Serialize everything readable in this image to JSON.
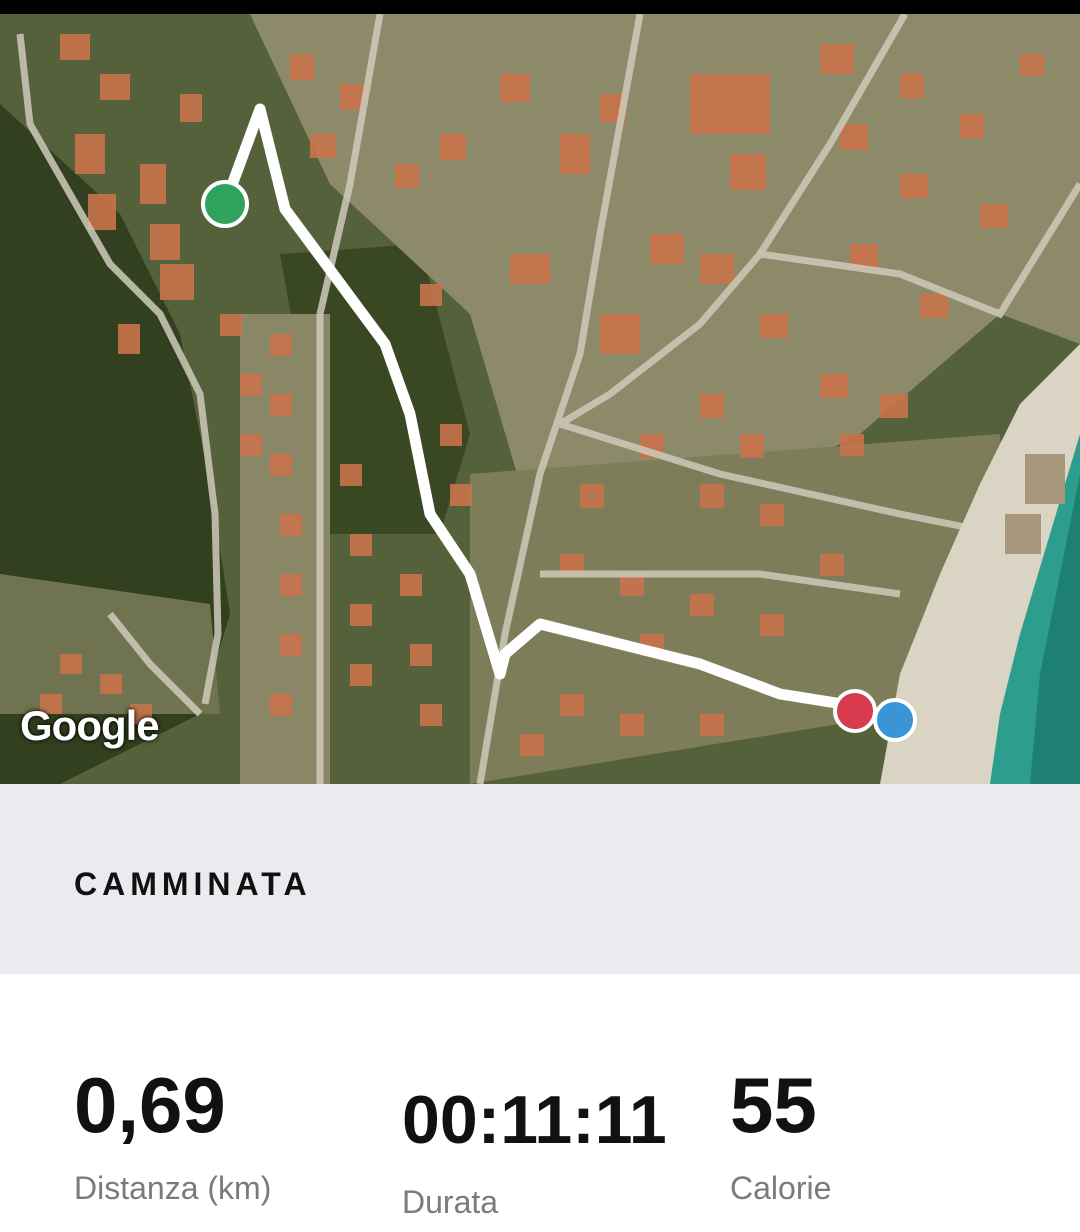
{
  "map": {
    "attribution": "Google",
    "markers": [
      {
        "name": "start",
        "color": "#2fa35e"
      },
      {
        "name": "end",
        "color": "#d83a4e"
      },
      {
        "name": "current",
        "color": "#3a95d6"
      }
    ],
    "route_color": "#ffffff"
  },
  "activity": {
    "title": "CAMMINATA"
  },
  "stats": {
    "distance": {
      "value": "0,69",
      "label": "Distanza (km)"
    },
    "duration": {
      "value": "00:11:11",
      "label": "Durata"
    },
    "calories": {
      "value": "55",
      "label": "Calorie"
    }
  }
}
